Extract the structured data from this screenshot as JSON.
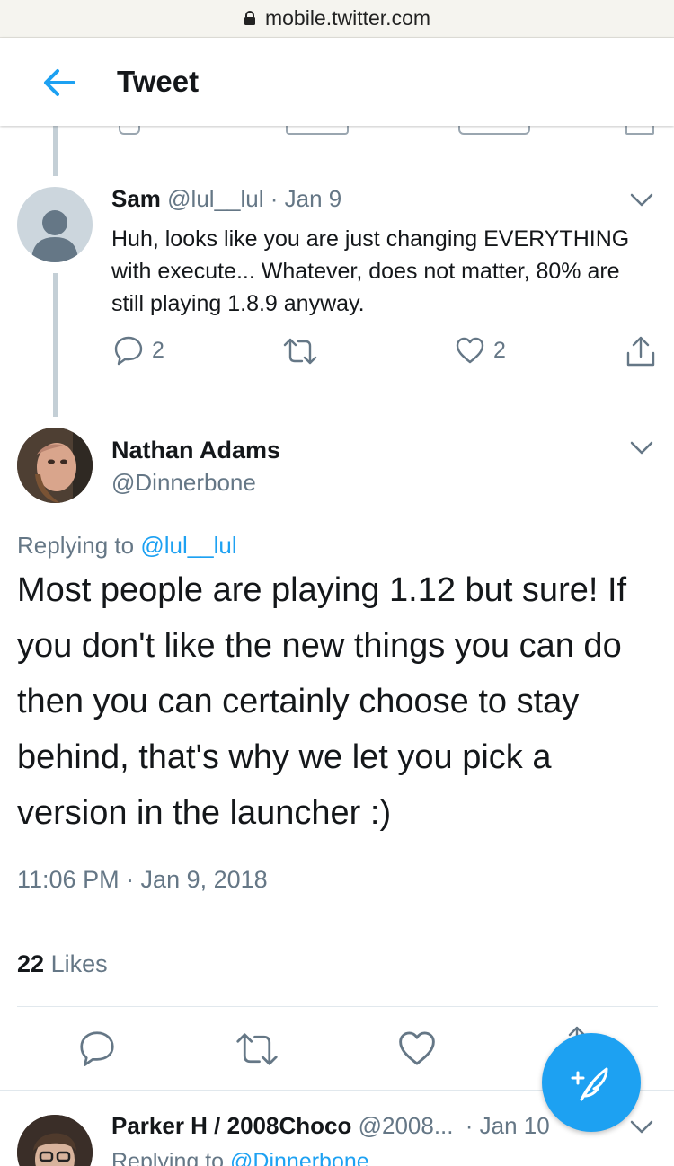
{
  "browser": {
    "url": "mobile.twitter.com"
  },
  "header": {
    "title": "Tweet"
  },
  "sam_tweet": {
    "name": "Sam",
    "handle": "@lul__lul",
    "separator": "·",
    "date": "Jan 9",
    "text": "Huh, looks like you are just changing EVERYTHING with execute... Whatever, does not matter, 80% are still playing 1.8.9 anyway.",
    "reply_count": "2",
    "like_count": "2"
  },
  "main_tweet": {
    "name": "Nathan Adams",
    "handle": "@Dinnerbone",
    "replying_label": "Replying to",
    "replying_to": "@lul__lul",
    "text": "Most people are playing 1.12 but sure! If you don't like the new things you can do then you can certainly choose to stay behind, that's why we let you pick a version in the launcher :)",
    "timestamp": "11:06 PM · Jan 9, 2018",
    "like_count": "22",
    "likes_label": "Likes"
  },
  "next_tweet": {
    "name": "Parker H / 2008Choco",
    "handle": "@2008...",
    "separator": "·",
    "date": "Jan 10",
    "replying_label": "Replying to",
    "replying_to": "@Dinnerbone"
  },
  "colors": {
    "accent": "#1da1f2",
    "secondary_text": "#657786",
    "primary_text": "#14171a",
    "thread_line": "#c4cfd6"
  }
}
